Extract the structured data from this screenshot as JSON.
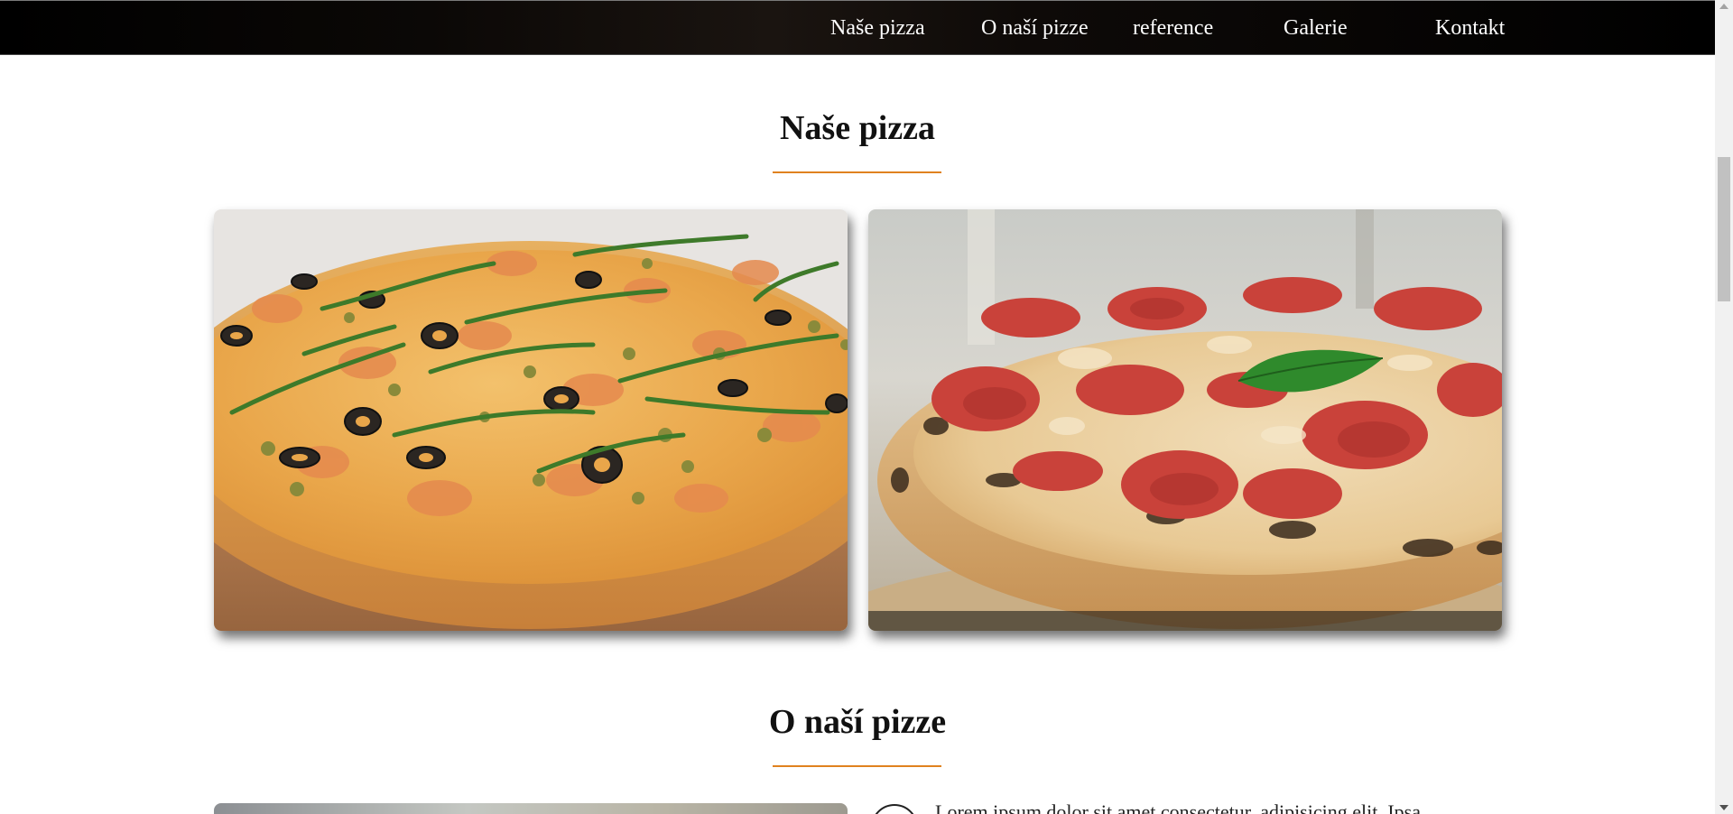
{
  "nav": {
    "items": [
      {
        "label": "Naše pizza"
      },
      {
        "label": "O naší pizze"
      },
      {
        "label": "reference"
      },
      {
        "label": "Galerie"
      },
      {
        "label": "Kontakt"
      }
    ]
  },
  "sections": {
    "our_pizza": {
      "title": "Naše pizza",
      "underline_color": "#e0821f",
      "images": [
        {
          "name": "seafood-pizza-image"
        },
        {
          "name": "pepperoni-pizza-image"
        }
      ]
    },
    "about": {
      "title": "O naší pizze",
      "text": "Lorem ipsum dolor sit amet consectetur, adipisicing elit. Ipsa"
    }
  },
  "colors": {
    "navbar_bg": "#000000",
    "accent": "#e0821f"
  }
}
